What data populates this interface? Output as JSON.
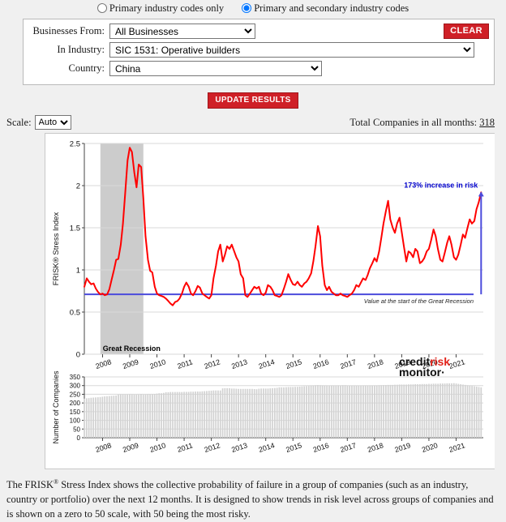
{
  "radio": {
    "options": [
      {
        "label": "Primary industry codes only",
        "selected": false
      },
      {
        "label": "Primary and secondary industry codes",
        "selected": true
      }
    ]
  },
  "filters": {
    "businesses_from": {
      "label": "Businesses From:",
      "value": "All Businesses"
    },
    "in_industry": {
      "label": "In Industry:",
      "value": "SIC 1531: Operative builders"
    },
    "country": {
      "label": "Country:",
      "value": "China"
    },
    "clear_label": "CLEAR",
    "update_label": "UPDATE RESULTS"
  },
  "scale": {
    "label": "Scale:",
    "value": "Auto"
  },
  "total": {
    "label": "Total Companies in all months:",
    "value": "318"
  },
  "logo": {
    "credit": "credit",
    "risk": "risk",
    "monitor": "monitor",
    "mark": "·"
  },
  "colors": {
    "line": "#ff0000",
    "baseline": "#4b4bdc",
    "recession_band": "#cccccc",
    "bars": "#d2d2d2",
    "brand_red": "#cf2027",
    "annotation": "#0000cc"
  },
  "footer": {
    "line1_a": "The FRISK",
    "line1_sup": "®",
    "line1_b": " Stress Index shows the collective probability of failure in a group of companies (such as an industry,",
    "line2": "country or portfolio) over the next 12 months.  It is designed to show trends in risk level across groups of companies",
    "line3": "and is shown on a zero to 50 scale, with 50 being the most risky."
  },
  "chart_data": [
    {
      "type": "line",
      "id": "frisk-stress-index",
      "title": "",
      "ylabel": "FRISK® Stress Index",
      "xlabel": "",
      "ylim": [
        0,
        2.5
      ],
      "yticks": [
        0,
        0.5,
        1,
        1.5,
        2,
        2.5
      ],
      "ytick_labels": [
        "0",
        "0.5",
        "1",
        "1.5",
        "2",
        "2.5"
      ],
      "xticks": [
        2008,
        2009,
        2010,
        2011,
        2012,
        2013,
        2014,
        2015,
        2016,
        2017,
        2018,
        2019,
        2020,
        2021
      ],
      "xtick_labels": [
        "2008",
        "2009",
        "2010",
        "2011",
        "2012",
        "2013",
        "2014",
        "2015",
        "2016",
        "2017",
        "2018",
        "2019",
        "2020",
        "2021"
      ],
      "xlim": [
        2007.33,
        2022.0
      ],
      "grid": true,
      "annotations": [
        {
          "text": "173% increase in risk",
          "color": "#0000cc",
          "x": 2021.4,
          "y": 1.95
        },
        {
          "text": "Value at the start of the Great Recession",
          "color": "#222222",
          "x": 2018.0,
          "y": 0.63
        },
        {
          "text": "Great Recession",
          "color": "#000000",
          "x": 2007.95,
          "y": 0.09
        }
      ],
      "baseline": {
        "value": 0.71,
        "label": "Value at the start of the Great Recession",
        "color": "#4b4bdc"
      },
      "recession_band": {
        "start": 2007.92,
        "end": 2009.5,
        "label": "Great Recession",
        "color": "#cccccc"
      },
      "end_marker": {
        "x": 2021.92,
        "value": 1.92,
        "color": "#4b4bdc"
      },
      "series": [
        {
          "name": "FRISK Stress Index",
          "color": "#ff0000",
          "x": [
            2007.33,
            2007.42,
            2007.5,
            2007.58,
            2007.67,
            2007.75,
            2007.83,
            2007.92,
            2008.0,
            2008.08,
            2008.17,
            2008.25,
            2008.33,
            2008.42,
            2008.5,
            2008.58,
            2008.67,
            2008.75,
            2008.83,
            2008.92,
            2009.0,
            2009.08,
            2009.17,
            2009.25,
            2009.33,
            2009.42,
            2009.5,
            2009.58,
            2009.67,
            2009.75,
            2009.83,
            2009.92,
            2010.0,
            2010.08,
            2010.17,
            2010.25,
            2010.33,
            2010.42,
            2010.5,
            2010.58,
            2010.67,
            2010.75,
            2010.83,
            2010.92,
            2011.0,
            2011.08,
            2011.17,
            2011.25,
            2011.33,
            2011.42,
            2011.5,
            2011.58,
            2011.67,
            2011.75,
            2011.83,
            2011.92,
            2012.0,
            2012.08,
            2012.17,
            2012.25,
            2012.33,
            2012.42,
            2012.5,
            2012.58,
            2012.67,
            2012.75,
            2012.83,
            2012.92,
            2013.0,
            2013.08,
            2013.17,
            2013.25,
            2013.33,
            2013.42,
            2013.5,
            2013.58,
            2013.67,
            2013.75,
            2013.83,
            2013.92,
            2014.0,
            2014.08,
            2014.17,
            2014.25,
            2014.33,
            2014.42,
            2014.5,
            2014.58,
            2014.67,
            2014.75,
            2014.83,
            2014.92,
            2015.0,
            2015.08,
            2015.17,
            2015.25,
            2015.33,
            2015.42,
            2015.5,
            2015.58,
            2015.67,
            2015.75,
            2015.83,
            2015.92,
            2016.0,
            2016.08,
            2016.17,
            2016.25,
            2016.33,
            2016.42,
            2016.5,
            2016.58,
            2016.67,
            2016.75,
            2016.83,
            2016.92,
            2017.0,
            2017.08,
            2017.17,
            2017.25,
            2017.33,
            2017.42,
            2017.5,
            2017.58,
            2017.67,
            2017.75,
            2017.83,
            2017.92,
            2018.0,
            2018.08,
            2018.17,
            2018.25,
            2018.33,
            2018.42,
            2018.5,
            2018.58,
            2018.67,
            2018.75,
            2018.83,
            2018.92,
            2019.0,
            2019.08,
            2019.17,
            2019.25,
            2019.33,
            2019.42,
            2019.5,
            2019.58,
            2019.67,
            2019.75,
            2019.83,
            2019.92,
            2020.0,
            2020.08,
            2020.17,
            2020.25,
            2020.33,
            2020.42,
            2020.5,
            2020.58,
            2020.67,
            2020.75,
            2020.83,
            2020.92,
            2021.0,
            2021.08,
            2021.17,
            2021.25,
            2021.33,
            2021.42,
            2021.5,
            2021.58,
            2021.67,
            2021.75,
            2021.83,
            2021.92
          ],
          "y": [
            0.8,
            0.9,
            0.86,
            0.83,
            0.84,
            0.78,
            0.74,
            0.71,
            0.72,
            0.7,
            0.71,
            0.77,
            0.88,
            1.0,
            1.12,
            1.13,
            1.3,
            1.55,
            1.9,
            2.3,
            2.45,
            2.4,
            2.15,
            1.98,
            2.25,
            2.22,
            1.85,
            1.4,
            1.12,
            0.99,
            0.97,
            0.8,
            0.72,
            0.7,
            0.69,
            0.68,
            0.66,
            0.63,
            0.6,
            0.58,
            0.62,
            0.63,
            0.66,
            0.72,
            0.8,
            0.85,
            0.8,
            0.72,
            0.7,
            0.75,
            0.81,
            0.79,
            0.72,
            0.7,
            0.68,
            0.66,
            0.7,
            0.9,
            1.05,
            1.22,
            1.3,
            1.1,
            1.18,
            1.28,
            1.25,
            1.3,
            1.23,
            1.15,
            1.1,
            0.95,
            0.9,
            0.7,
            0.68,
            0.72,
            0.76,
            0.8,
            0.78,
            0.8,
            0.72,
            0.7,
            0.73,
            0.82,
            0.8,
            0.76,
            0.7,
            0.69,
            0.68,
            0.7,
            0.78,
            0.86,
            0.95,
            0.88,
            0.83,
            0.82,
            0.86,
            0.82,
            0.8,
            0.84,
            0.86,
            0.9,
            0.96,
            1.1,
            1.28,
            1.52,
            1.4,
            1.05,
            0.82,
            0.76,
            0.8,
            0.74,
            0.72,
            0.7,
            0.7,
            0.72,
            0.7,
            0.69,
            0.68,
            0.7,
            0.72,
            0.76,
            0.82,
            0.8,
            0.85,
            0.9,
            0.88,
            0.94,
            1.02,
            1.08,
            1.14,
            1.1,
            1.22,
            1.38,
            1.55,
            1.7,
            1.82,
            1.6,
            1.5,
            1.44,
            1.55,
            1.62,
            1.45,
            1.28,
            1.1,
            1.22,
            1.2,
            1.15,
            1.25,
            1.22,
            1.08,
            1.1,
            1.14,
            1.22,
            1.25,
            1.35,
            1.48,
            1.4,
            1.25,
            1.12,
            1.1,
            1.2,
            1.32,
            1.4,
            1.3,
            1.15,
            1.12,
            1.18,
            1.3,
            1.42,
            1.38,
            1.5,
            1.6,
            1.55,
            1.58,
            1.72,
            1.8,
            1.92
          ]
        }
      ]
    },
    {
      "type": "bar",
      "id": "number-of-companies",
      "ylabel": "Number of Companies",
      "xlabel": "",
      "ylim": [
        0,
        350
      ],
      "yticks": [
        0,
        50,
        100,
        150,
        200,
        250,
        300,
        350
      ],
      "ytick_labels": [
        "0",
        "50",
        "100",
        "150",
        "200",
        "250",
        "300",
        "350"
      ],
      "xticks": [
        2008,
        2009,
        2010,
        2011,
        2012,
        2013,
        2014,
        2015,
        2016,
        2017,
        2018,
        2019,
        2020,
        2021
      ],
      "xtick_labels": [
        "2008",
        "2009",
        "2010",
        "2011",
        "2012",
        "2013",
        "2014",
        "2015",
        "2016",
        "2017",
        "2018",
        "2019",
        "2020",
        "2021"
      ],
      "grid": true,
      "bar_color": "#d2d2d2",
      "values": [
        225,
        227,
        228,
        230,
        231,
        232,
        233,
        234,
        236,
        238,
        239,
        240,
        241,
        242,
        243,
        248,
        249,
        249,
        249,
        249,
        249,
        249,
        248,
        248,
        248,
        252,
        249,
        249,
        250,
        250,
        251,
        252,
        254,
        256,
        256,
        258,
        262,
        262,
        263,
        263,
        263,
        263,
        263,
        263,
        264,
        264,
        264,
        265,
        265,
        266,
        266,
        266,
        267,
        268,
        269,
        270,
        271,
        272,
        272,
        272,
        272,
        284,
        285,
        285,
        285,
        283,
        283,
        282,
        281,
        281,
        281,
        281,
        281,
        281,
        281,
        280,
        279,
        282,
        283,
        283,
        283,
        283,
        284,
        285,
        286,
        287,
        290,
        290,
        290,
        291,
        292,
        292,
        292,
        293,
        293,
        294,
        295,
        296,
        297,
        298,
        300,
        301,
        302,
        303,
        302,
        301,
        300,
        300,
        300,
        300,
        300,
        300,
        301,
        301,
        302,
        302,
        300,
        299,
        299,
        299,
        299,
        299,
        299,
        300,
        300,
        300,
        300,
        300,
        301,
        301,
        302,
        302,
        303,
        303,
        304,
        304,
        304,
        305,
        305,
        306,
        306,
        306,
        306,
        307,
        307,
        307,
        308,
        308,
        308,
        309,
        309,
        309,
        310,
        310,
        311,
        311,
        311,
        312,
        312,
        312,
        313,
        313,
        313,
        314,
        312,
        310,
        308,
        306,
        304,
        302,
        300,
        298,
        296,
        294,
        292,
        290
      ]
    }
  ]
}
